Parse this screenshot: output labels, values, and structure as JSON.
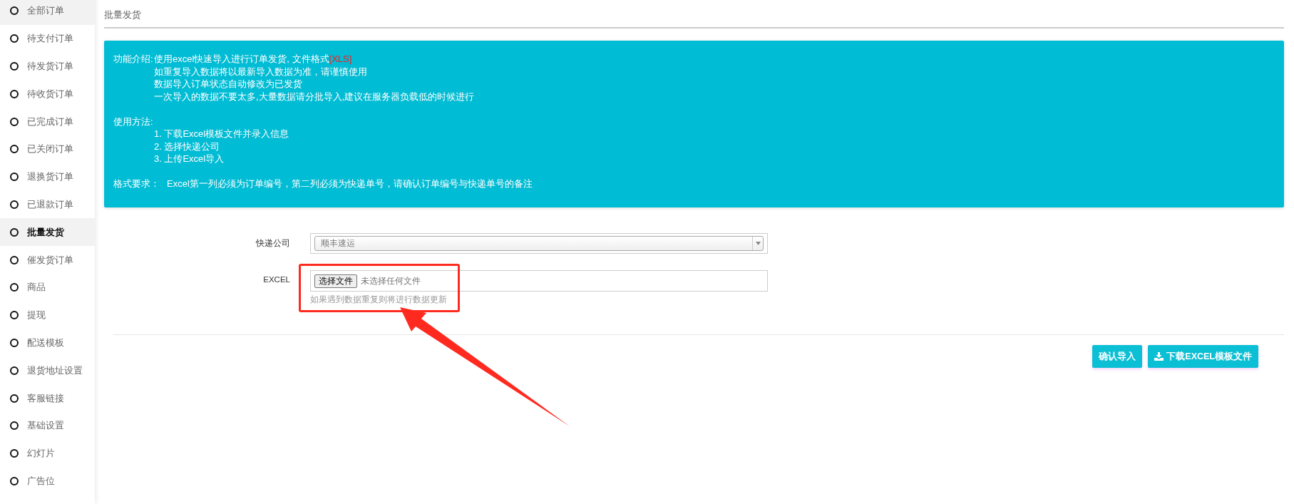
{
  "sidebar": {
    "items": [
      {
        "label": "全部订单",
        "selected": false,
        "highlighted": true
      },
      {
        "label": "待支付订单",
        "selected": false,
        "highlighted": false
      },
      {
        "label": "待发货订单",
        "selected": false,
        "highlighted": false
      },
      {
        "label": "待收货订单",
        "selected": false,
        "highlighted": false
      },
      {
        "label": "已完成订单",
        "selected": false,
        "highlighted": false
      },
      {
        "label": "已关闭订单",
        "selected": false,
        "highlighted": false
      },
      {
        "label": "退换货订单",
        "selected": false,
        "highlighted": false
      },
      {
        "label": "已退款订单",
        "selected": false,
        "highlighted": false
      },
      {
        "label": "批量发货",
        "selected": true,
        "highlighted": true
      },
      {
        "label": "催发货订单",
        "selected": false,
        "highlighted": false
      },
      {
        "label": "商品",
        "selected": false,
        "highlighted": false
      },
      {
        "label": "提现",
        "selected": false,
        "highlighted": false
      },
      {
        "label": "配送模板",
        "selected": false,
        "highlighted": false
      },
      {
        "label": "退货地址设置",
        "selected": false,
        "highlighted": false
      },
      {
        "label": "客服链接",
        "selected": false,
        "highlighted": false
      },
      {
        "label": "基础设置",
        "selected": false,
        "highlighted": false
      },
      {
        "label": "幻灯片",
        "selected": false,
        "highlighted": false
      },
      {
        "label": "广告位",
        "selected": false,
        "highlighted": false
      }
    ]
  },
  "page_title": "批量发货",
  "notice": {
    "intro_label": "功能介绍:",
    "intro_lines": [
      "使用excel快速导入进行订单发货, 文件格式",
      "如重复导入数据将以最新导入数据为准，请谨慎使用",
      "数据导入订单状态自动修改为已发货",
      "一次导入的数据不要太多,大量数据请分批导入,建议在服务器负载低的时候进行"
    ],
    "format_tag": "[XLS]",
    "usage_label": "使用方法:",
    "usage_steps": [
      "1. 下载Excel模板文件并录入信息",
      "2. 选择快递公司",
      "3. 上传Excel导入"
    ],
    "requirement_label": "格式要求：",
    "requirement": "Excel第一列必须为订单编号，第二列必须为快递单号，请确认订单编号与快递单号的备注"
  },
  "form": {
    "courier": {
      "label": "快递公司",
      "value": "顺丰速运"
    },
    "excel": {
      "label": "EXCEL",
      "button": "选择文件",
      "status": "未选择任何文件",
      "hint": "如果遇到数据重复则将进行数据更新"
    }
  },
  "buttons": [
    {
      "label": "确认导入",
      "kind": "plain"
    },
    {
      "label": "下载EXCEL模板文件",
      "kind": "download"
    }
  ],
  "annotations": {
    "highlight_box": true,
    "pointer_arrow": true
  }
}
